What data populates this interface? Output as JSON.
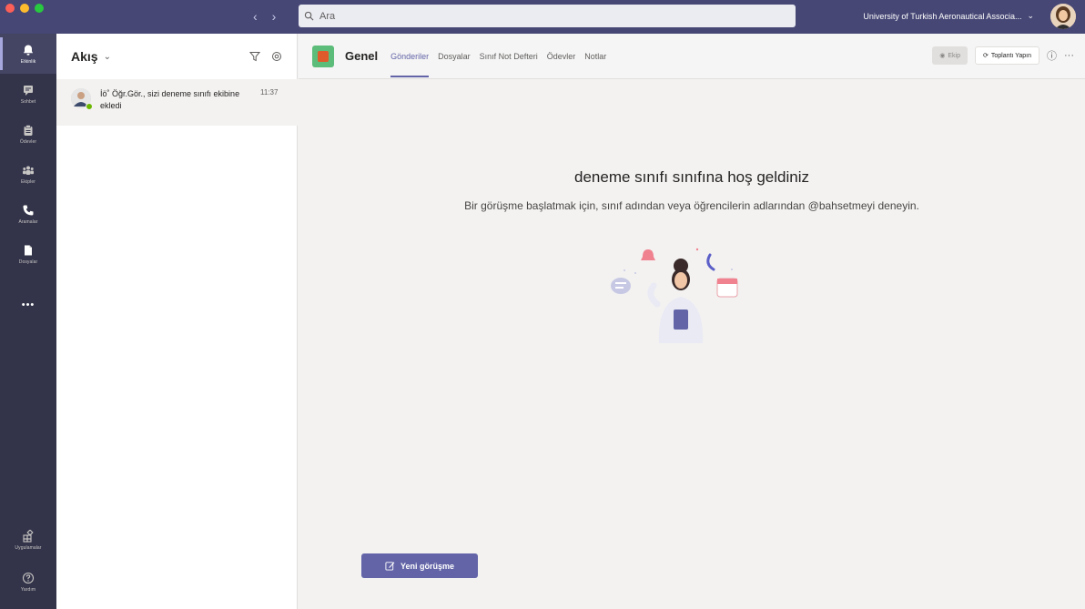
{
  "titlebar": {
    "search_placeholder": "Ara",
    "org_name": "University of Turkish Aeronautical Associa...",
    "org_chevron": "⌄",
    "nav_back": "‹",
    "nav_forward": "›"
  },
  "rail": {
    "items": [
      {
        "label": "Etkinlik",
        "icon": "bell-icon",
        "active": true
      },
      {
        "label": "Sohbet",
        "icon": "chat-icon",
        "active": false
      },
      {
        "label": "Ödevler",
        "icon": "assignments-icon",
        "active": false
      },
      {
        "label": "Ekipler",
        "icon": "teams-icon",
        "active": false
      },
      {
        "label": "Aramalar",
        "icon": "phone-icon",
        "active": false
      },
      {
        "label": "Dosyalar",
        "icon": "files-icon",
        "active": false
      }
    ],
    "more": "•••",
    "bottom_items": [
      {
        "label": "Uygulamalar",
        "icon": "apps-icon"
      },
      {
        "label": "Yardım",
        "icon": "help-icon"
      }
    ]
  },
  "activity": {
    "title": "Akış",
    "chevron": "⌄",
    "feed": [
      {
        "text": "İö˚ Öğr.Gör., sizi deneme sınıfı ekibine ekledi",
        "time": "11:37"
      }
    ]
  },
  "channel": {
    "name": "Genel",
    "tabs": [
      {
        "label": "Gönderiler",
        "active": true
      },
      {
        "label": "Dosyalar",
        "active": false
      },
      {
        "label": "Sınıf Not Defteri",
        "active": false
      },
      {
        "label": "Ödevler",
        "active": false
      },
      {
        "label": "Notlar",
        "active": false
      }
    ],
    "team_button": "Ekip",
    "meet_button": "Toplantı Yapın",
    "info_icon": "ⓘ",
    "more_icon": "···"
  },
  "welcome": {
    "title": "deneme sınıfı sınıfına hoş geldiniz",
    "subtitle": "Bir görüşme başlatmak için, sınıf adından veya öğrencilerin adlarından @bahsetmeyi deneyin."
  },
  "new_conversation": "Yeni görüşme",
  "colors": {
    "brand": "#6264a7",
    "titlebar": "#464775",
    "rail": "#33344a",
    "presence_available": "#6bb700"
  }
}
